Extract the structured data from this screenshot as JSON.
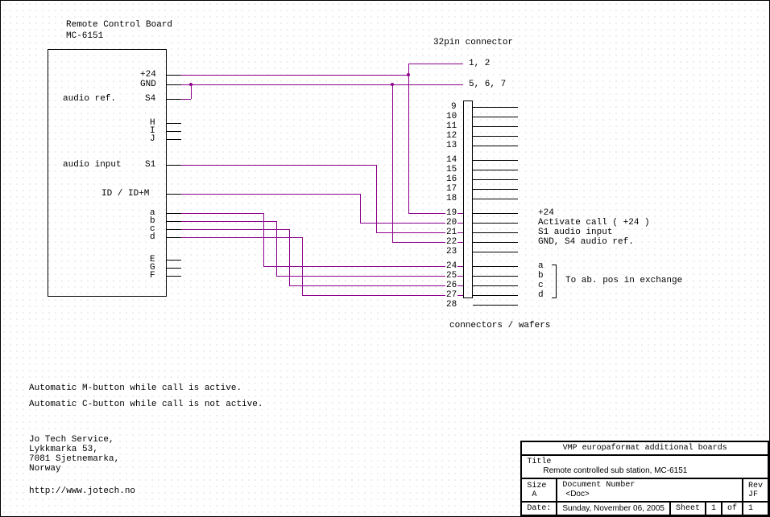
{
  "board": {
    "title": "Remote Control Board",
    "part": "MC-6151"
  },
  "pins_left": {
    "p24": "+24",
    "gnd": "GND",
    "s4": "S4",
    "s4_label": "audio ref.",
    "h": "H",
    "i": "I",
    "j": "J",
    "s1": "S1",
    "s1_label": "audio input",
    "id": "ID / ID+M",
    "a": "a",
    "b": "b",
    "c": "c",
    "d": "d",
    "e": "E",
    "g": "G",
    "f": "F"
  },
  "connector": {
    "title": "32pin connector",
    "footer": "connectors / wafers",
    "p12": "1, 2",
    "p567": "5, 6, 7",
    "pins": [
      "9",
      "10",
      "11",
      "12",
      "13",
      "14",
      "15",
      "16",
      "17",
      "18",
      "19",
      "20",
      "21",
      "22",
      "23",
      "24",
      "25",
      "26",
      "27",
      "28"
    ]
  },
  "annot": {
    "p24": "+24",
    "act": "Activate call ( +24  )",
    "s1": "S1 audio input",
    "gnds4": "GND, S4 audio ref.",
    "a": "a",
    "b": "b",
    "c": "c",
    "d": "d",
    "bracket": "To ab. pos in exchange"
  },
  "notes": {
    "m": "Automatic M-button while call is active.",
    "c": "Automatic C-button while call is not active."
  },
  "contact": {
    "l1": "Jo Tech Service,",
    "l2": "Lykkmarka 53,",
    "l3": "7081 Sjetnemarka,",
    "l4": "Norway",
    "url": "http://www.jotech.no"
  },
  "titleblock": {
    "project": "VMP  europaformat  additional  boards",
    "title_lbl": "Title",
    "title": "Remote controlled sub station, MC-6151",
    "size_lbl": "Size",
    "size": "A",
    "docnum_lbl": "Document Number",
    "docnum": "<Doc>",
    "rev_lbl": "Rev",
    "rev": "JF",
    "date_lbl": "Date:",
    "date": "Sunday, November 06, 2005",
    "sheet_lbl": "Sheet",
    "sheet_n": "1",
    "sheet_of": "of",
    "sheet_t": "1"
  }
}
